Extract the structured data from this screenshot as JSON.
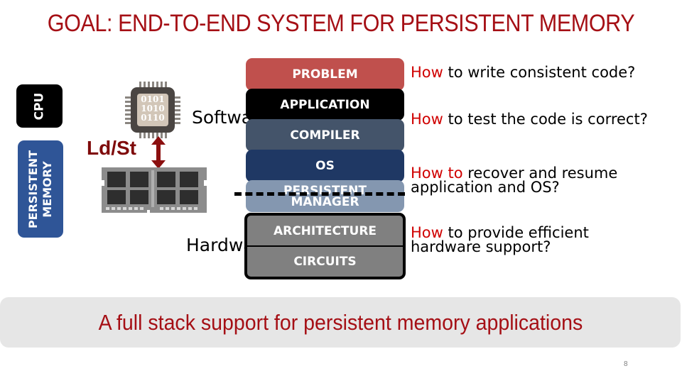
{
  "slide": {
    "title": "GOAL: END-TO-END SYSTEM FOR PERSISTENT MEMORY",
    "page_number": "8"
  },
  "left_labels": {
    "cpu": "CPU",
    "persistent_memory_line1": "PERSISTENT",
    "persistent_memory_line2": "MEMORY"
  },
  "diagram": {
    "chip_bits": [
      "0101",
      "1010",
      "0110"
    ],
    "ld_st_label": "Ld/St",
    "software_label": "Software",
    "hardware_label": "Hardware",
    "colors": {
      "accent_red": "#a50f15",
      "how_red": "#d00000",
      "arrow_red": "#7f0b0b"
    }
  },
  "stack": {
    "problem": "PROBLEM",
    "application": "APPLICATION",
    "compiler": "COMPILER",
    "os": "OS",
    "persistent_manager_line1": "PERSISTENT",
    "persistent_manager_line2": "MANAGER",
    "architecture": "ARCHITECTURE",
    "circuits": "CIRCUITS"
  },
  "questions": [
    {
      "highlight": "How",
      "text": " to write consistent code?"
    },
    {
      "highlight": "How",
      "text": " to test the code is correct?"
    },
    {
      "highlight": "How to",
      "text": " recover and resume",
      "line2": "application and OS?"
    },
    {
      "highlight": "How",
      "text": " to provide efficient",
      "line2": "hardware support?"
    }
  ],
  "banner": {
    "text": "A full stack support for persistent memory applications"
  }
}
